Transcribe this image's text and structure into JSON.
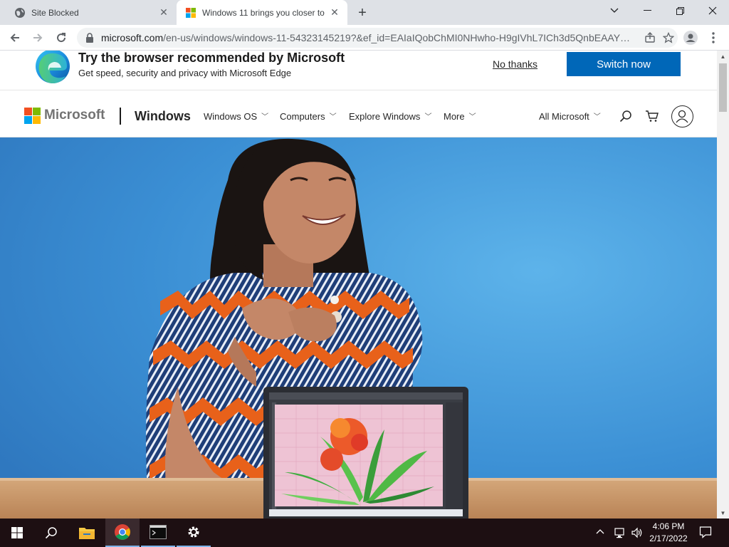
{
  "browser": {
    "tabs": [
      {
        "title": "Site Blocked",
        "active": false
      },
      {
        "title": "Windows 11 brings you closer to",
        "active": true
      }
    ],
    "new_tab": "+",
    "url_host": "microsoft.com",
    "url_path": "/en-us/windows/windows-11-54323145219?&ef_id=EAIaIQobChMI0NHwho-H9gIVhL7ICh3d5QnbEAAY…"
  },
  "banner": {
    "title": "Try the browser recommended by Microsoft",
    "subtitle": "Get speed, security and privacy with Microsoft Edge",
    "no_thanks": "No thanks",
    "switch_now": "Switch now"
  },
  "header": {
    "brand": "Microsoft",
    "product": "Windows",
    "nav": [
      "Windows OS",
      "Computers",
      "Explore Windows",
      "More"
    ],
    "all_microsoft": "All Microsoft"
  },
  "taskbar": {
    "time": "4:06 PM",
    "date": "2/17/2022"
  },
  "colors": {
    "accent": "#0067b8",
    "hero_bg": "#3d8fd6",
    "ms_red": "#f25022",
    "ms_green": "#7fba00",
    "ms_blue": "#00a4ef",
    "ms_yellow": "#ffb900",
    "taskbar": "#1d0f12"
  }
}
